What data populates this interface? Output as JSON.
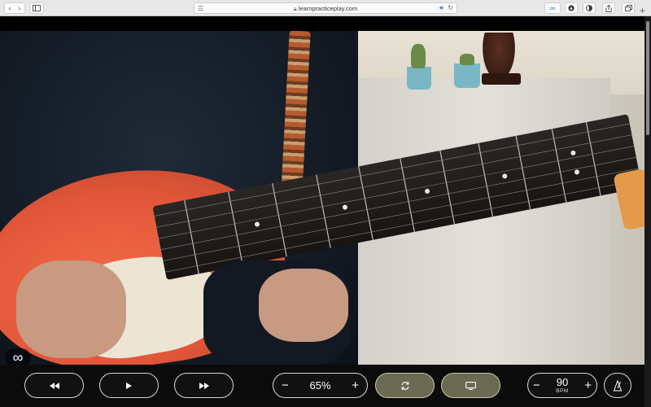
{
  "browser": {
    "url": "learnpracticeplay.com",
    "lock_icon": "lock-icon",
    "icons": {
      "back": "chevron-left-icon",
      "forward": "chevron-right-icon",
      "sidebar": "sidebar-icon",
      "reader": "reader-lines-icon",
      "audio": "speaker-icon",
      "reload": "reload-icon",
      "ext1": "infinity-extension-icon",
      "ext2": "download-icon",
      "ext3": "contrast-icon",
      "share": "share-icon",
      "tabs": "tabs-icon",
      "new_tab": "plus-icon"
    }
  },
  "video": {
    "overlay_icon": "infinity-loop-icon"
  },
  "player": {
    "rewind_icon": "rewind-icon",
    "play_icon": "play-icon",
    "forward_icon": "fast-forward-icon",
    "speed": {
      "value": "65%",
      "minus_icon": "minus-icon",
      "plus_icon": "plus-icon"
    },
    "loop_icon": "loop-icon",
    "screen_icon": "screen-icon",
    "tempo": {
      "value": "90",
      "unit": "BPM",
      "minus_icon": "minus-icon",
      "plus_icon": "plus-icon"
    },
    "metronome_icon": "metronome-icon"
  },
  "colors": {
    "accent_button": "#6a6a52",
    "control_bar": "#0b0b0b",
    "guitar": "#e2573a"
  }
}
